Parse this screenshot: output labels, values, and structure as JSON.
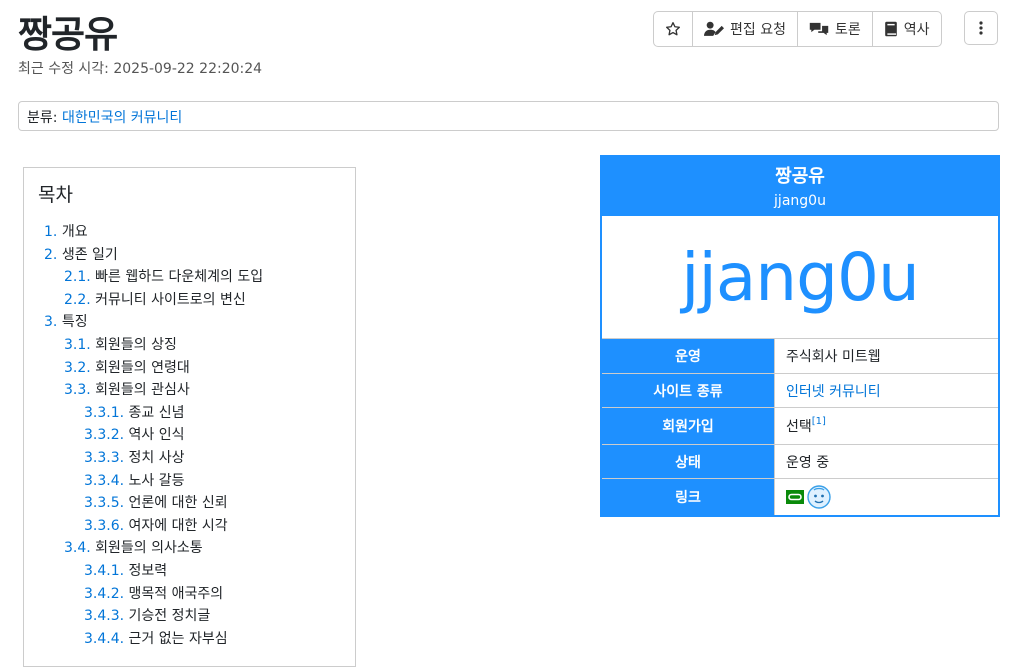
{
  "page": {
    "title": "짱공유",
    "last_modified": "최근 수정 시각: 2025-09-22 22:20:24"
  },
  "toolbar": {
    "star_icon": "star-icon",
    "edit_request_label": "편집 요청",
    "discussion_label": "토론",
    "history_label": "역사",
    "more_icon": "more-vertical-icon"
  },
  "category": {
    "prefix": "분류:",
    "link": "대한민국의 커뮤니티"
  },
  "toc": {
    "title": "목차",
    "items": [
      {
        "num": "1.",
        "label": "개요",
        "level": 1
      },
      {
        "num": "2.",
        "label": "생존 일기",
        "level": 1
      },
      {
        "num": "2.1.",
        "label": "빠른 웹하드 다운체계의 도입",
        "level": 2
      },
      {
        "num": "2.2.",
        "label": "커뮤니티 사이트로의 변신",
        "level": 2
      },
      {
        "num": "3.",
        "label": "특징",
        "level": 1
      },
      {
        "num": "3.1.",
        "label": "회원들의 상징",
        "level": 2
      },
      {
        "num": "3.2.",
        "label": "회원들의 연령대",
        "level": 2
      },
      {
        "num": "3.3.",
        "label": "회원들의 관심사",
        "level": 2
      },
      {
        "num": "3.3.1.",
        "label": "종교 신념",
        "level": 3
      },
      {
        "num": "3.3.2.",
        "label": "역사 인식",
        "level": 3
      },
      {
        "num": "3.3.3.",
        "label": "정치 사상",
        "level": 3
      },
      {
        "num": "3.3.4.",
        "label": "노사 갈등",
        "level": 3
      },
      {
        "num": "3.3.5.",
        "label": "언론에 대한 신뢰",
        "level": 3
      },
      {
        "num": "3.3.6.",
        "label": "여자에 대한 시각",
        "level": 3
      },
      {
        "num": "3.4.",
        "label": "회원들의 의사소통",
        "level": 2
      },
      {
        "num": "3.4.1.",
        "label": "정보력",
        "level": 3
      },
      {
        "num": "3.4.2.",
        "label": "맹목적 애국주의",
        "level": 3
      },
      {
        "num": "3.4.3.",
        "label": "기승전 정치글",
        "level": 3
      },
      {
        "num": "3.4.4.",
        "label": "근거 없는 자부심",
        "level": 3
      }
    ]
  },
  "infobox": {
    "name": "짱공유",
    "subname": "jjang0u",
    "logo_text": "jjang0u",
    "accent_color": "#1e90ff",
    "rows": [
      {
        "label": "운영",
        "value": "주식회사 미트웹",
        "link": false
      },
      {
        "label": "사이트 종류",
        "value": "인터넷 커뮤니티",
        "link": true
      },
      {
        "label": "회원가입",
        "value": "선택",
        "footnote": "[1]",
        "link": false
      },
      {
        "label": "상태",
        "value": "운영 중",
        "link": false
      },
      {
        "label": "링크",
        "icons": [
          "link-icon",
          "mascot-face-icon"
        ]
      }
    ]
  }
}
